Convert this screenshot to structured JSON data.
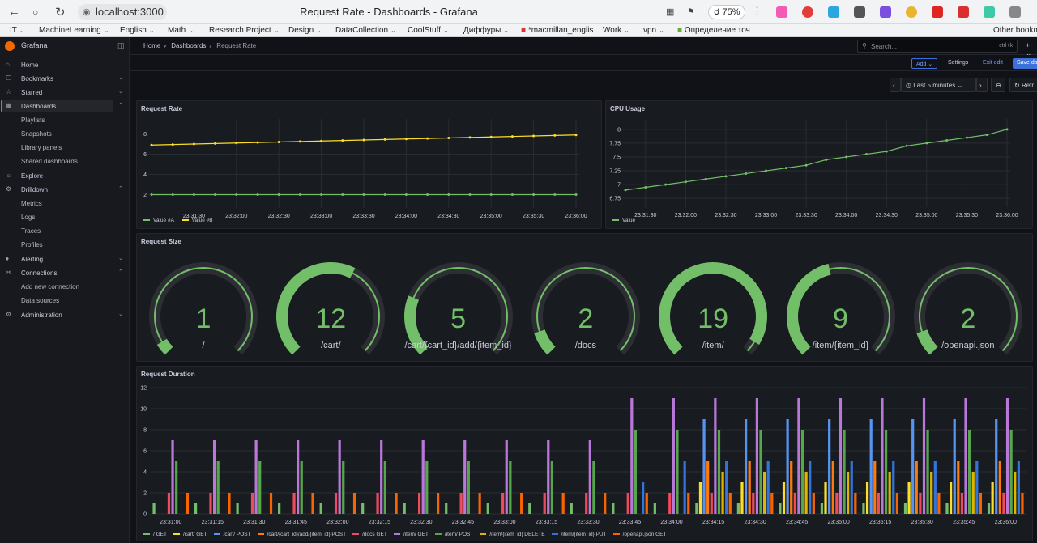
{
  "browser": {
    "url": "localhost:3000",
    "title": "Request Rate - Dashboards - Grafana",
    "zoom": "75%",
    "bookmarks": [
      "IT",
      "MachineLearning",
      "English",
      "Math",
      "Research Project",
      "Design",
      "DataCollection",
      "CoolStuff",
      "Диффуры",
      "*macmillan_englis",
      "Work",
      "vpn",
      "Определение точ",
      "Other bookm"
    ]
  },
  "sidebar": {
    "brand": "Grafana",
    "items": [
      {
        "label": "Home",
        "icon": "home-icon"
      },
      {
        "label": "Bookmarks",
        "icon": "bookmark-icon"
      },
      {
        "label": "Starred",
        "icon": "star-icon"
      },
      {
        "label": "Dashboards",
        "icon": "dashboards-icon"
      },
      {
        "label": "Playlists"
      },
      {
        "label": "Snapshots"
      },
      {
        "label": "Library panels"
      },
      {
        "label": "Shared dashboards"
      },
      {
        "label": "Explore",
        "icon": "compass-icon"
      },
      {
        "label": "Drilldown",
        "icon": "drilldown-icon"
      },
      {
        "label": "Metrics"
      },
      {
        "label": "Logs"
      },
      {
        "label": "Traces"
      },
      {
        "label": "Profiles"
      },
      {
        "label": "Alerting",
        "icon": "bell-icon"
      },
      {
        "label": "Connections",
        "icon": "plug-icon"
      },
      {
        "label": "Add new connection"
      },
      {
        "label": "Data sources"
      },
      {
        "label": "Administration",
        "icon": "gear-icon"
      }
    ]
  },
  "breadcrumb": {
    "home": "Home",
    "dashboards": "Dashboards",
    "current": "Request Rate"
  },
  "search": {
    "placeholder": "Search...",
    "shortcut": "ctrl+k"
  },
  "toolbar": {
    "add": "Add",
    "settings": "Settings",
    "exit_edit": "Exit edit",
    "save": "Save da"
  },
  "time": {
    "range": "Last 5 minutes",
    "refresh": "Refr"
  },
  "colors": {
    "green": "#73bf69",
    "yellow": "#fade2a",
    "blue": "#5794f2",
    "orange": "#ff780a",
    "red": "#f2495c",
    "purple": "#b877d9",
    "dkgreen": "#56a64b"
  },
  "chart_data": [
    {
      "type": "line",
      "title": "Request Rate",
      "x": [
        "23:31:00",
        "23:31:15",
        "23:31:30",
        "23:31:45",
        "23:32:00",
        "23:32:15",
        "23:32:30",
        "23:32:45",
        "23:33:00",
        "23:33:15",
        "23:33:30",
        "23:33:45",
        "23:34:00",
        "23:34:15",
        "23:34:30",
        "23:34:45",
        "23:35:00",
        "23:35:15",
        "23:35:30",
        "23:35:45",
        "23:36:00"
      ],
      "xticks": [
        "23:31:30",
        "23:32:00",
        "23:32:30",
        "23:33:00",
        "23:33:30",
        "23:34:00",
        "23:34:30",
        "23:35:00",
        "23:35:30",
        "23:36:00"
      ],
      "yticks": [
        2,
        4,
        6,
        8
      ],
      "ylim": [
        1,
        9
      ],
      "series": [
        {
          "name": "Value #A",
          "color": "#73bf69",
          "values": [
            2,
            2,
            2,
            2,
            2,
            2,
            2,
            2,
            2,
            2,
            2,
            2,
            2,
            2,
            2,
            2,
            2,
            2,
            2,
            2,
            2
          ]
        },
        {
          "name": "Value #B",
          "color": "#fade2a",
          "values": [
            6.9,
            6.95,
            7.0,
            7.05,
            7.1,
            7.15,
            7.2,
            7.25,
            7.3,
            7.35,
            7.4,
            7.45,
            7.5,
            7.55,
            7.6,
            7.65,
            7.7,
            7.75,
            7.8,
            7.85,
            7.9
          ]
        }
      ]
    },
    {
      "type": "line",
      "title": "CPU Usage",
      "x": [
        "23:31:15",
        "23:31:30",
        "23:31:45",
        "23:32:00",
        "23:32:15",
        "23:32:30",
        "23:32:45",
        "23:33:00",
        "23:33:15",
        "23:33:30",
        "23:33:45",
        "23:34:00",
        "23:34:15",
        "23:34:30",
        "23:34:45",
        "23:35:00",
        "23:35:15",
        "23:35:30",
        "23:35:45",
        "23:36:00"
      ],
      "xticks": [
        "23:31:30",
        "23:32:00",
        "23:32:30",
        "23:33:00",
        "23:33:30",
        "23:34:00",
        "23:34:30",
        "23:35:00",
        "23:35:30",
        "23:36:00"
      ],
      "yticks": [
        "6.75",
        "7",
        "7.25",
        "7.5",
        "7.75",
        "8"
      ],
      "ylim": [
        6.65,
        8.1
      ],
      "series": [
        {
          "name": "Value",
          "color": "#73bf69",
          "values": [
            6.9,
            6.95,
            7.0,
            7.05,
            7.1,
            7.15,
            7.2,
            7.25,
            7.3,
            7.35,
            7.45,
            7.5,
            7.55,
            7.6,
            7.7,
            7.75,
            7.8,
            7.85,
            7.9,
            8.0
          ]
        }
      ]
    },
    {
      "type": "gauge",
      "title": "Request Size",
      "max": 20,
      "gauges": [
        {
          "label": "/",
          "value": 1
        },
        {
          "label": "/cart/",
          "value": 12
        },
        {
          "label": "/cart/{cart_id}/add/{item_id}",
          "value": 5
        },
        {
          "label": "/docs",
          "value": 2
        },
        {
          "label": "/item/",
          "value": 19
        },
        {
          "label": "/item/{item_id}",
          "value": 9
        },
        {
          "label": "/openapi.json",
          "value": 2
        }
      ]
    },
    {
      "type": "bar",
      "title": "Request Duration",
      "xticks": [
        "23:31:00",
        "23:31:15",
        "23:31:30",
        "23:31:45",
        "23:32:00",
        "23:32:15",
        "23:32:30",
        "23:32:45",
        "23:33:00",
        "23:33:15",
        "23:33:30",
        "23:33:45",
        "23:34:00",
        "23:34:15",
        "23:34:30",
        "23:34:45",
        "23:35:00",
        "23:35:15",
        "23:35:30",
        "23:35:45",
        "23:36:00"
      ],
      "yticks": [
        0,
        2,
        4,
        6,
        8,
        10,
        12
      ],
      "ylim": [
        0,
        12
      ],
      "series": [
        {
          "name": "/ GET",
          "color": "#73bf69",
          "values": [
            1,
            1,
            1,
            1,
            1,
            1,
            1,
            1,
            1,
            1,
            1,
            1,
            1,
            1,
            1,
            1,
            1,
            1,
            1,
            1,
            1
          ]
        },
        {
          "name": "/cart/ GET",
          "color": "#fade2a",
          "values": [
            0,
            0,
            0,
            0,
            0,
            0,
            0,
            0,
            0,
            0,
            0,
            0,
            0,
            3,
            3,
            3,
            3,
            3,
            3,
            3,
            3
          ]
        },
        {
          "name": "/cart/ POST",
          "color": "#5794f2",
          "values": [
            0,
            0,
            0,
            0,
            0,
            0,
            0,
            0,
            0,
            0,
            0,
            0,
            0,
            9,
            9,
            9,
            9,
            9,
            9,
            9,
            9
          ]
        },
        {
          "name": "/cart/{cart_id}/add/{item_id} POST",
          "color": "#ff780a",
          "values": [
            0,
            0,
            0,
            0,
            0,
            0,
            0,
            0,
            0,
            0,
            0,
            0,
            0,
            5,
            5,
            5,
            5,
            5,
            5,
            5,
            5
          ]
        },
        {
          "name": "/docs GET",
          "color": "#f2495c",
          "values": [
            2,
            2,
            2,
            2,
            2,
            2,
            2,
            2,
            2,
            2,
            2,
            2,
            2,
            2,
            2,
            2,
            2,
            2,
            2,
            2,
            2
          ]
        },
        {
          "name": "/item/ GET",
          "color": "#b877d9",
          "values": [
            7,
            7,
            7,
            7,
            7,
            7,
            7,
            7,
            7,
            7,
            7,
            11,
            11,
            11,
            11,
            11,
            11,
            11,
            11,
            11,
            11
          ]
        },
        {
          "name": "/item/ POST",
          "color": "#56a64b",
          "values": [
            5,
            5,
            5,
            5,
            5,
            5,
            5,
            5,
            5,
            5,
            5,
            8,
            8,
            8,
            8,
            8,
            8,
            8,
            8,
            8,
            8
          ]
        },
        {
          "name": "/item/{item_id} DELETE",
          "color": "#e0b400",
          "values": [
            0,
            0,
            0,
            0,
            0,
            0,
            0,
            0,
            0,
            0,
            0,
            0,
            0,
            4,
            4,
            4,
            4,
            4,
            4,
            4,
            4
          ]
        },
        {
          "name": "/item/{item_id} PUT",
          "color": "#3274d9",
          "values": [
            0,
            0,
            0,
            0,
            0,
            0,
            0,
            0,
            0,
            0,
            0,
            3,
            5,
            5,
            5,
            5,
            5,
            5,
            5,
            5,
            5
          ]
        },
        {
          "name": "/openapi.json GET",
          "color": "#fa6400",
          "values": [
            2,
            2,
            2,
            2,
            2,
            2,
            2,
            2,
            2,
            2,
            2,
            2,
            2,
            2,
            2,
            2,
            2,
            2,
            2,
            2,
            2
          ]
        }
      ]
    }
  ]
}
